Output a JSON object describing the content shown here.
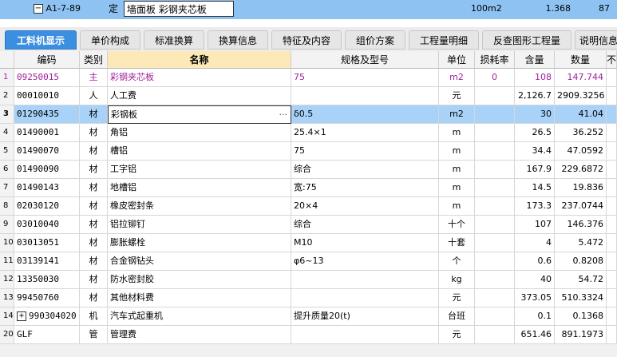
{
  "top_row": {
    "code": "A1-7-89",
    "type": "定",
    "name": "墙面板 彩钢夹芯板",
    "unit": "100m2",
    "quantity": "1.368",
    "extra": "87"
  },
  "tabs": [
    {
      "label": "工料机显示",
      "active": true
    },
    {
      "label": "单价构成",
      "active": false
    },
    {
      "label": "标准换算",
      "active": false
    },
    {
      "label": "换算信息",
      "active": false
    },
    {
      "label": "特征及内容",
      "active": false
    },
    {
      "label": "组价方案",
      "active": false
    },
    {
      "label": "工程量明细",
      "active": false
    },
    {
      "label": "反查图形工程量",
      "active": false
    },
    {
      "label": "说明信息",
      "active": false
    }
  ],
  "columns": {
    "code": "编码",
    "category": "类别",
    "name": "名称",
    "spec": "规格及型号",
    "unit": "单位",
    "loss_rate": "损耗率",
    "content": "含量",
    "quantity": "数量",
    "extra": "不"
  },
  "rows": [
    {
      "num": "1",
      "code": "09250015",
      "category": "主",
      "name": "彩钢夹芯板",
      "spec": "75",
      "unit": "m2",
      "loss_rate": "0",
      "content": "108",
      "quantity": "147.744"
    },
    {
      "num": "2",
      "code": "00010010",
      "category": "人",
      "name": "人工费",
      "spec": "",
      "unit": "元",
      "loss_rate": "",
      "content": "2,126.7",
      "quantity": "2909.3256"
    },
    {
      "num": "3",
      "code": "01290435",
      "category": "材",
      "name": "彩钢板",
      "spec": "δ0.5",
      "unit": "m2",
      "loss_rate": "",
      "content": "30",
      "quantity": "41.04"
    },
    {
      "num": "4",
      "code": "01490001",
      "category": "材",
      "name": "角铝",
      "spec": "25.4×1",
      "unit": "m",
      "loss_rate": "",
      "content": "26.5",
      "quantity": "36.252"
    },
    {
      "num": "5",
      "code": "01490070",
      "category": "材",
      "name": "槽铝",
      "spec": "75",
      "unit": "m",
      "loss_rate": "",
      "content": "34.4",
      "quantity": "47.0592"
    },
    {
      "num": "6",
      "code": "01490090",
      "category": "材",
      "name": "工字铝",
      "spec": "综合",
      "unit": "m",
      "loss_rate": "",
      "content": "167.9",
      "quantity": "229.6872"
    },
    {
      "num": "7",
      "code": "01490143",
      "category": "材",
      "name": "地槽铝",
      "spec": "宽:75",
      "unit": "m",
      "loss_rate": "",
      "content": "14.5",
      "quantity": "19.836"
    },
    {
      "num": "8",
      "code": "02030120",
      "category": "材",
      "name": "橡皮密封条",
      "spec": "20×4",
      "unit": "m",
      "loss_rate": "",
      "content": "173.3",
      "quantity": "237.0744"
    },
    {
      "num": "9",
      "code": "03010040",
      "category": "材",
      "name": "铝拉铆钉",
      "spec": "综合",
      "unit": "十个",
      "loss_rate": "",
      "content": "107",
      "quantity": "146.376"
    },
    {
      "num": "10",
      "code": "03013051",
      "category": "材",
      "name": "膨胀螺栓",
      "spec": "M10",
      "unit": "十套",
      "loss_rate": "",
      "content": "4",
      "quantity": "5.472"
    },
    {
      "num": "11",
      "code": "03139141",
      "category": "材",
      "name": "合金钢钻头",
      "spec": "φ6~13",
      "unit": "个",
      "loss_rate": "",
      "content": "0.6",
      "quantity": "0.8208"
    },
    {
      "num": "12",
      "code": "13350030",
      "category": "材",
      "name": "防水密封胶",
      "spec": "",
      "unit": "kg",
      "loss_rate": "",
      "content": "40",
      "quantity": "54.72"
    },
    {
      "num": "13",
      "code": "99450760",
      "category": "材",
      "name": "其他材料费",
      "spec": "",
      "unit": "元",
      "loss_rate": "",
      "content": "373.05",
      "quantity": "510.3324"
    },
    {
      "num": "14",
      "code": "990304020",
      "category": "机",
      "name": "汽车式起重机",
      "spec": "提升质量20(t)",
      "unit": "台班",
      "loss_rate": "",
      "content": "0.1",
      "quantity": "0.1368",
      "expandable": true
    },
    {
      "num": "20",
      "code": "GLF",
      "category": "管",
      "name": "管理费",
      "spec": "",
      "unit": "元",
      "loss_rate": "",
      "content": "651.46",
      "quantity": "891.1973"
    }
  ]
}
